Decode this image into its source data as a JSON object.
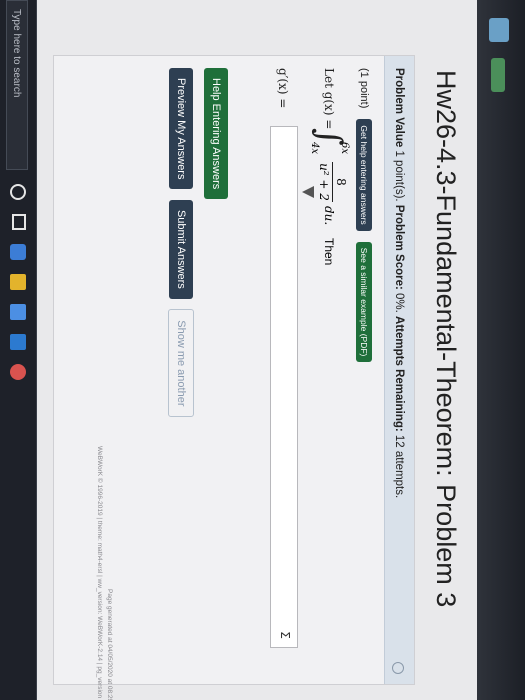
{
  "page": {
    "title": "Hw26-4.3-Fundamental-Theorem: Problem 3"
  },
  "problem_info": {
    "label": "Problem Value",
    "value": "1 point(s).",
    "score_label": "Problem Score:",
    "score": "0%.",
    "attempts_label": "Attempts Remaining:",
    "attempts": "12 attempts."
  },
  "problem": {
    "points": "(1 point)",
    "get_help": "Get help entering answers",
    "similar_example": "See a similar example (PDF)",
    "let": "Let g(x) =",
    "upper_limit": "6x",
    "lower_limit": "4x",
    "numerator": "8",
    "denominator": "u² + 2",
    "du": "du.",
    "then": "Then",
    "gprime_label": "g′(x) =",
    "mq_icon": "Σ"
  },
  "buttons": {
    "help": "Help Entering Answers",
    "preview": "Preview My Answers",
    "submit": "Submit Answers",
    "show_me": "Show me another"
  },
  "footer": {
    "line1": "Page generated at 04/05/2020 at 08:29pm EDT",
    "line2": "WeBWorK © 1996-2019 | theme: math4-ersl | ww_version: WeBWorK-2.14 | pg_version PG-2.14 | The WeBWorK Project"
  },
  "taskbar": {
    "search_placeholder": "Type here to search"
  },
  "colors": {
    "primary_button": "#2e3f52",
    "help_button": "#1f6f3a",
    "info_bar": "#d9e1ea"
  }
}
